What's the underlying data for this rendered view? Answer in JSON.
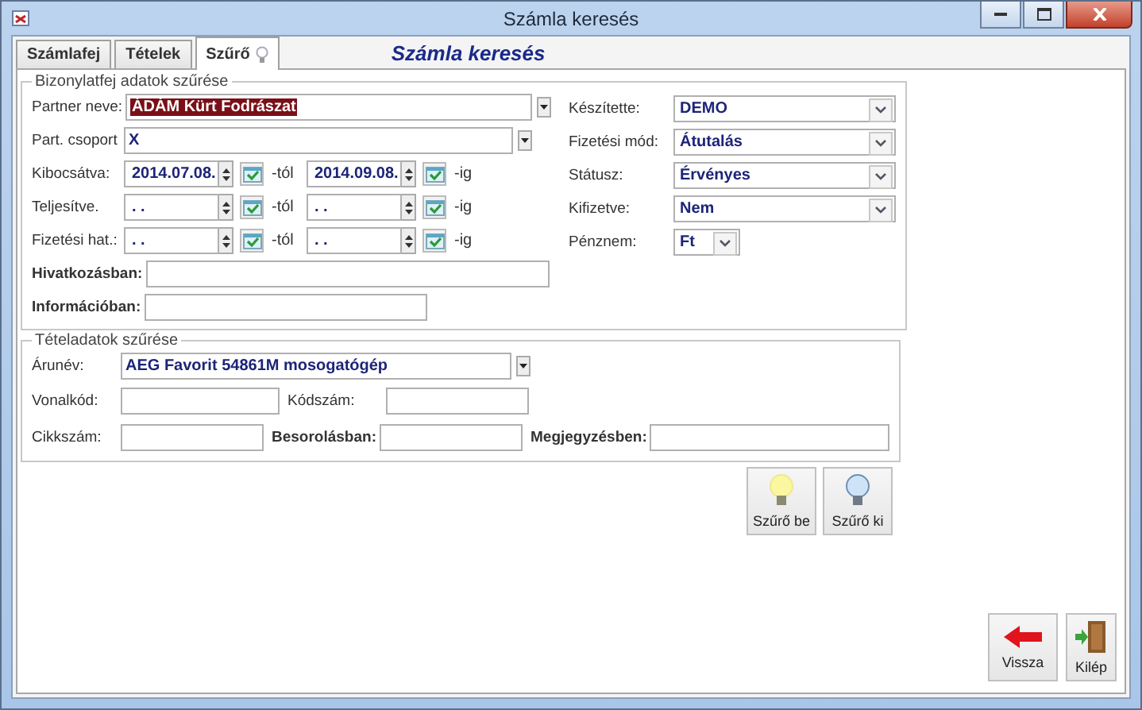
{
  "window": {
    "title": "Számla keresés"
  },
  "tabs": [
    {
      "label": "Számlafej",
      "selected": false,
      "icon": false
    },
    {
      "label": "Tételek",
      "selected": false,
      "icon": false
    },
    {
      "label": "Szűrő",
      "selected": true,
      "icon": true
    }
  ],
  "heading": "Számla keresés",
  "header_filter": {
    "title": "Bizonylatfej adatok szűrése",
    "combos": [
      {
        "label": "Partner neve:",
        "value": "ÁDÁM Kürt Fodrászat",
        "highlighted": true
      },
      {
        "label": "Part. csoport",
        "value": "X",
        "highlighted": false
      }
    ],
    "date_rows": [
      {
        "label": "Kibocsátva:",
        "from": "2014.07.08.",
        "from_suffix": "-tól",
        "to": "2014.09.08.",
        "to_suffix": "-ig"
      },
      {
        "label": "Teljesítve.",
        "from": ". .",
        "from_suffix": "-tól",
        "to": ". .",
        "to_suffix": "-ig"
      },
      {
        "label": "Fizetési hat.:",
        "from": ". .",
        "from_suffix": "-tól",
        "to": ". .",
        "to_suffix": "-ig"
      }
    ],
    "text_fields": [
      {
        "label": "Hivatkozásban:"
      },
      {
        "label": "Információban:"
      }
    ],
    "selects": [
      {
        "label": "Készítette:",
        "value": "DEMO"
      },
      {
        "label": "Fizetési mód:",
        "value": "Átutalás"
      },
      {
        "label": "Státusz:",
        "value": "Érvényes"
      },
      {
        "label": "Kifizetve:",
        "value": "Nem"
      },
      {
        "label": "Pénznem:",
        "value": "Ft"
      }
    ]
  },
  "item_filter": {
    "title": "Tételadatok szűrése",
    "product": {
      "label": "Árunév:",
      "value": "AEG Favorit 54861M mosogatógép"
    },
    "rows": [
      [
        {
          "label": "Vonalkód:",
          "bold": false
        },
        {
          "label": "Kódszám:",
          "bold": false
        }
      ],
      [
        {
          "label": "Cikkszám:",
          "bold": false
        },
        {
          "label": "Besorolásban:",
          "bold": true
        },
        {
          "label": "Megjegyzésben:",
          "bold": true
        }
      ]
    ]
  },
  "filter_buttons": [
    {
      "label": "Szűrő be",
      "kind": "bulb-on"
    },
    {
      "label": "Szűrő ki",
      "kind": "bulb-off"
    }
  ],
  "footer_buttons": [
    {
      "label": "Vissza",
      "kind": "back"
    },
    {
      "label": "Kilép",
      "kind": "exit"
    }
  ]
}
